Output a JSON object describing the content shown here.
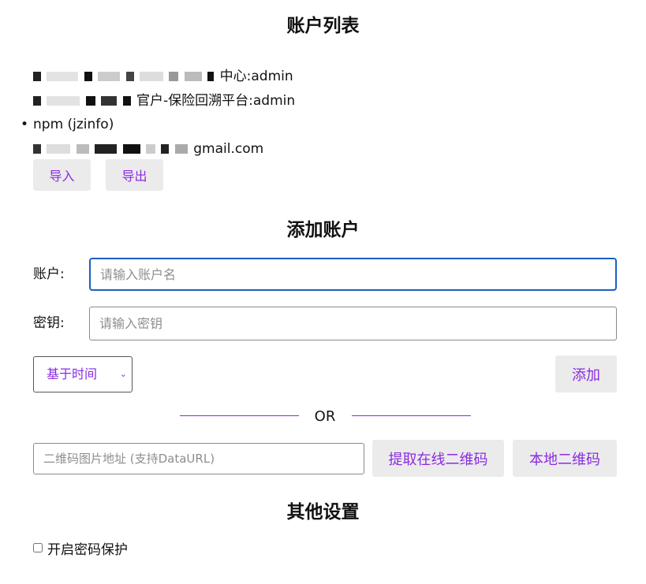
{
  "headings": {
    "account_list": "账户列表",
    "add_account": "添加账户",
    "other_settings": "其他设置"
  },
  "accounts": [
    {
      "label": "中心:admin",
      "mosaic": true
    },
    {
      "label": "官户-保险回溯平台:admin",
      "mosaic": true
    },
    {
      "label": "npm (jzinfo)",
      "mosaic": false
    },
    {
      "label": "gmail.com",
      "mosaic": true
    }
  ],
  "buttons": {
    "import": "导入",
    "export": "导出",
    "add": "添加",
    "fetch_online_qr": "提取在线二维码",
    "local_qr": "本地二维码"
  },
  "form": {
    "account_label": "账户:",
    "account_placeholder": "请输入账户名",
    "key_label": "密钥:",
    "key_placeholder": "请输入密钥",
    "type_select": "基于时间",
    "or_text": "OR",
    "qr_placeholder": "二维码图片地址 (支持DataURL)"
  },
  "settings": {
    "password_protection": "开启密码保护",
    "password_protection_checked": false
  },
  "colors": {
    "accent": "#8a2be2",
    "focus_border": "#1a5fc2",
    "button_bg": "#ebebeb"
  }
}
